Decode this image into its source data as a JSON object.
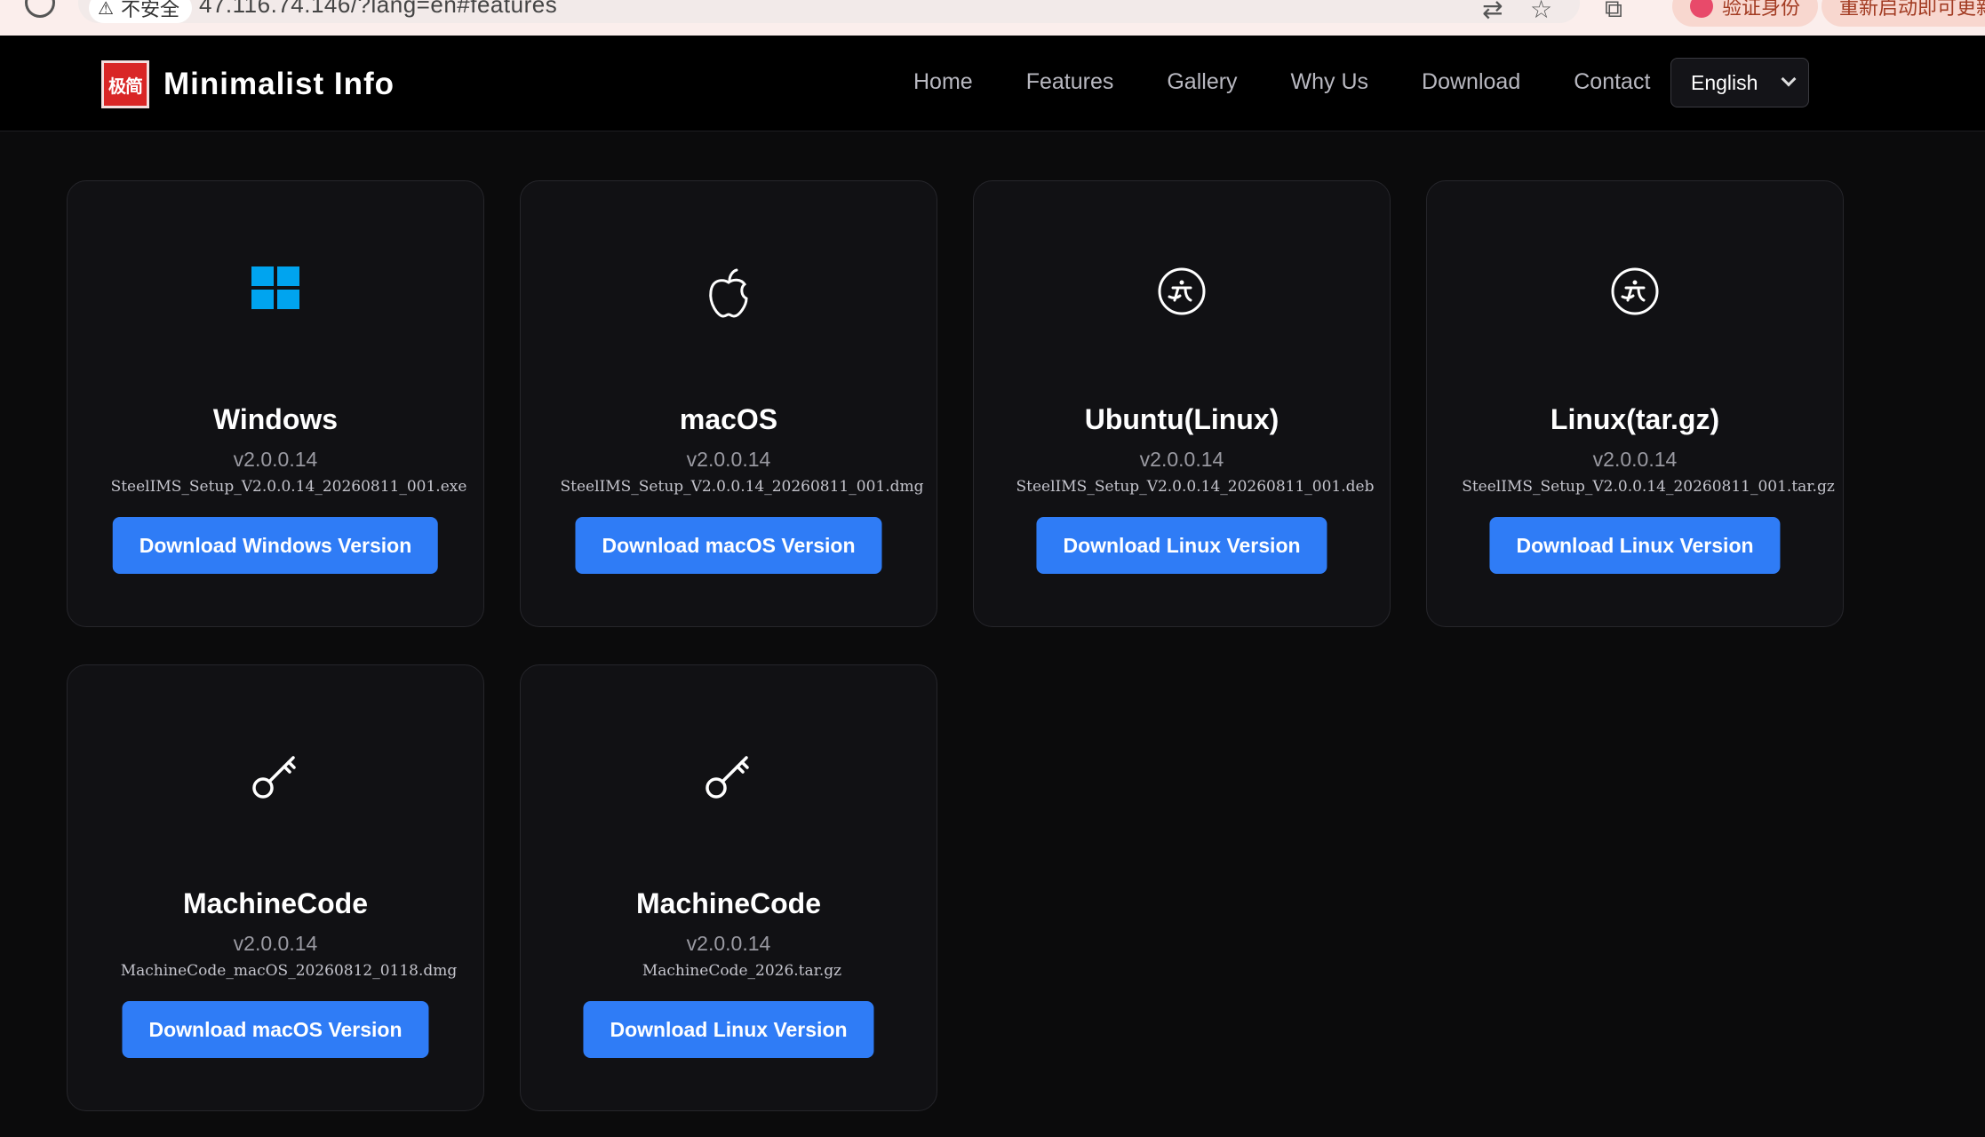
{
  "browser": {
    "security_label": "不安全",
    "url": "47.116.74.146/?lang=en#features",
    "pill_verify": "验证身份",
    "pill_restart": "重新启动即可更新"
  },
  "brand": {
    "name": "Minimalist Info",
    "logo_text": "极简"
  },
  "nav": {
    "links": [
      "Home",
      "Features",
      "Gallery",
      "Why Us",
      "Download",
      "Contact"
    ],
    "language": "English"
  },
  "cards": [
    {
      "icon": "windows-icon",
      "title": "Windows",
      "version": "v2.0.0.14",
      "file": "SteelIMS_Setup_V2.0.0.14_20260811_001.exe",
      "button": "Download Windows Version"
    },
    {
      "icon": "apple-icon",
      "title": "macOS",
      "version": "v2.0.0.14",
      "file": "SteelIMS_Setup_V2.0.0.14_20260811_001.dmg",
      "button": "Download macOS Version"
    },
    {
      "icon": "ubuntu-icon",
      "title": "Ubuntu(Linux)",
      "version": "v2.0.0.14",
      "file": "SteelIMS_Setup_V2.0.0.14_20260811_001.deb",
      "button": "Download Linux Version"
    },
    {
      "icon": "ubuntu-icon",
      "title": "Linux(tar.gz)",
      "version": "v2.0.0.14",
      "file": "SteelIMS_Setup_V2.0.0.14_20260811_001.tar.gz",
      "button": "Download Linux Version"
    },
    {
      "icon": "key-icon",
      "title": "MachineCode",
      "version": "v2.0.0.14",
      "file": "MachineCode_macOS_20260812_0118.dmg",
      "button": "Download macOS Version"
    },
    {
      "icon": "key-icon",
      "title": "MachineCode",
      "version": "v2.0.0.14",
      "file": "MachineCode_2026.tar.gz",
      "button": "Download Linux Version"
    }
  ],
  "colors": {
    "accent": "#2f7cf6",
    "windows": "#00a4ef",
    "card_bg": "#111114",
    "page_bg": "#0b0b0c"
  }
}
